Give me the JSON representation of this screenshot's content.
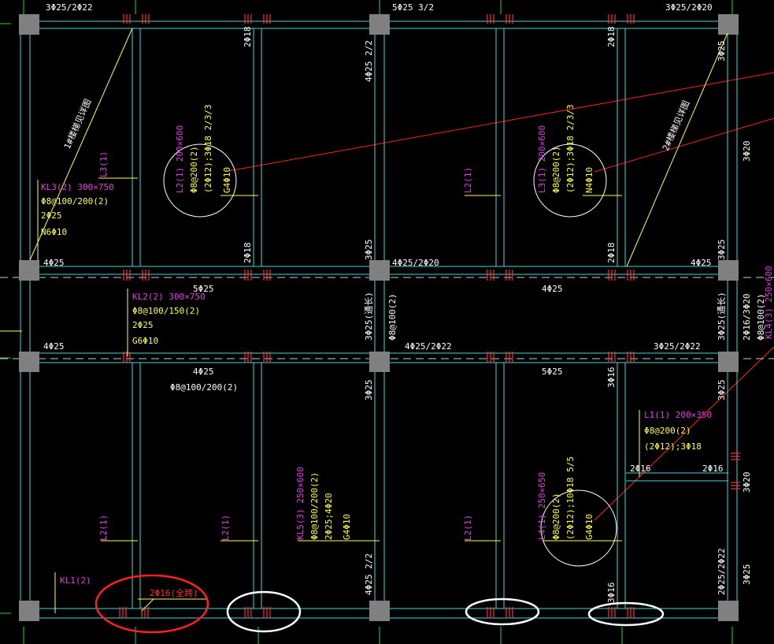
{
  "colors": {
    "background": "#000000",
    "beam": "#40d8d8",
    "column": "#808080",
    "white_text": "#ffffff",
    "yellow_text": "#ffff40",
    "magenta_text": "#e040e0",
    "red_line": "#ff2020",
    "red_mark": "#ff3030",
    "green_axis": "#30d030",
    "highlight_red": "#ff2020",
    "highlight_white": "#ffffff"
  },
  "top_labels": {
    "tl": "3Φ25/2Φ22",
    "tm": "5Φ25 3/2",
    "tr": "3Φ25/2Φ20"
  },
  "row1_labels": {
    "a": "4Φ25",
    "b": "4Φ25/2Φ20",
    "c": "4Φ25"
  },
  "row2_labels": {
    "a": "5Φ25",
    "b": "4Φ25",
    "c": "4Φ25",
    "d": "4Φ25/2Φ22",
    "e": "3Φ25/2Φ22"
  },
  "row3_labels": {
    "a": "4Φ25",
    "b": "Φ8@100/200(2)",
    "c": "5Φ25"
  },
  "vertical_labels": {
    "v1": "2Φ18",
    "v2": "2Φ18",
    "v3": "4Φ25 2/2",
    "v4": "3Φ25",
    "v5": "2Φ18",
    "v6": "2Φ18",
    "v7": "3Φ25",
    "v8": "3Φ20",
    "v9": "3Φ25",
    "v10": "3Φ25(通长)",
    "v11": "Φ8@100(2)",
    "v12": "3Φ25(通长)",
    "v13": "2Φ16/3Φ20",
    "v14": "Φ8@100(2)",
    "v15": "3Φ25",
    "v16": "3Φ16",
    "v17": "3Φ25",
    "v18": "3Φ20",
    "v19": "4Φ25 2/2",
    "v20": "3Φ16",
    "v21": "2Φ25/2Φ22",
    "v22": "3Φ25"
  },
  "stair1": "1#楼梯见详图",
  "stair2": "2#楼梯见详图",
  "kl3": {
    "name": "KL3(2) 300×750",
    "stirrup": "Φ8@100/200(2)",
    "top": "2Φ25",
    "side": "N6Φ10"
  },
  "l3_left": "L3(1)",
  "l2_top": {
    "name": "L2(1) 200×600",
    "stirrup": "Φ8@200(2)",
    "top": "(2Φ12);3Φ18 2/3/3",
    "side": "G4Φ10"
  },
  "l2_mid": "L2(1)",
  "l3_right": {
    "name": "L3(1) 200×600",
    "stirrup": "Φ8@200(2)",
    "top": "(2Φ12);3Φ18 2/3/3",
    "side": "N4Φ10"
  },
  "kl2": {
    "name": "KL2(2) 300×750",
    "stirrup": "Φ8@100/150(2)",
    "top": "2Φ25",
    "side": "G6Φ10"
  },
  "kl5": {
    "name": "KL5(3) 250×600",
    "stirrup": "Φ8@100/200(2)",
    "top": "2Φ25;4Φ20",
    "side": "G4Φ10"
  },
  "l4": {
    "name": "L4(1) 250×650",
    "stirrup": "Φ8@200(2)",
    "top": "(2Φ12);10Φ18 5/5",
    "side": "G4Φ10"
  },
  "l1": {
    "name": "L1(1) 200×350",
    "stirrup": "Φ8@200(2)",
    "top": "(2Φ12);3Φ18"
  },
  "l1_small_a": "2Φ16",
  "l1_small_b": "2Φ16",
  "l2_bottom_1": "L2(1)",
  "l2_bottom_2": "L2(1)",
  "l2_bottom_3": "L2(1)",
  "kl1": "KL1(2)",
  "kl1_note": "2Φ16(全跨)",
  "right_edge_label": "KL4(3) 250×600"
}
